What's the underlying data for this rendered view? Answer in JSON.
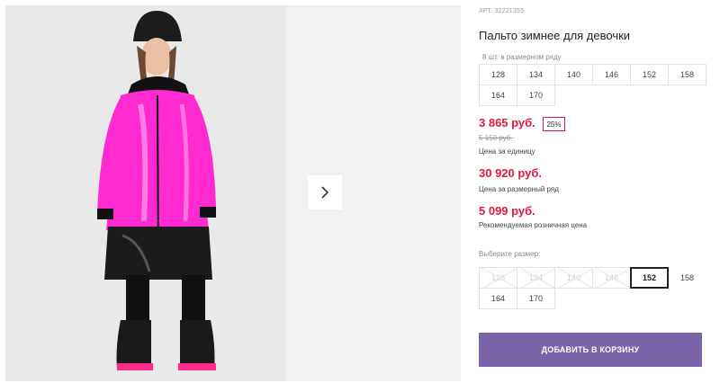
{
  "product": {
    "article": "АРТ. 32221355",
    "title": "Пальто зимнее для девочки",
    "image_alt": "Девочка в розовом зимнем пальто"
  },
  "pack": {
    "caption": "8 шт. в размерном ряду",
    "sizes": [
      "128",
      "134",
      "140",
      "146",
      "152",
      "158",
      "164",
      "170"
    ]
  },
  "prices": {
    "unit_price": "3 865 руб.",
    "discount": "25%",
    "old_price": "5 150 руб.",
    "unit_caption": "Цена за единицу",
    "pack_price": "30 920 руб.",
    "pack_caption": "Цена за размерный ряд",
    "rrp_price": "5 099 руб.",
    "rrp_caption": "Рекомендуемая розничная цена"
  },
  "size_select": {
    "caption": "Выберите размер:",
    "sizes": [
      {
        "label": "128",
        "state": "disabled"
      },
      {
        "label": "134",
        "state": "disabled"
      },
      {
        "label": "140",
        "state": "disabled"
      },
      {
        "label": "146",
        "state": "disabled"
      },
      {
        "label": "152",
        "state": "selected"
      },
      {
        "label": "158",
        "state": "available"
      },
      {
        "label": "164",
        "state": "available"
      },
      {
        "label": "170",
        "state": "available"
      }
    ]
  },
  "cart_button": {
    "label": "ДОБАВИТЬ В КОРЗИНУ"
  },
  "icons": {
    "next": "chevron-right-icon"
  },
  "colors": {
    "accent_price": "#e3173f",
    "button_bg": "#7a64a9",
    "jacket_pink": "#ff2bd0"
  }
}
